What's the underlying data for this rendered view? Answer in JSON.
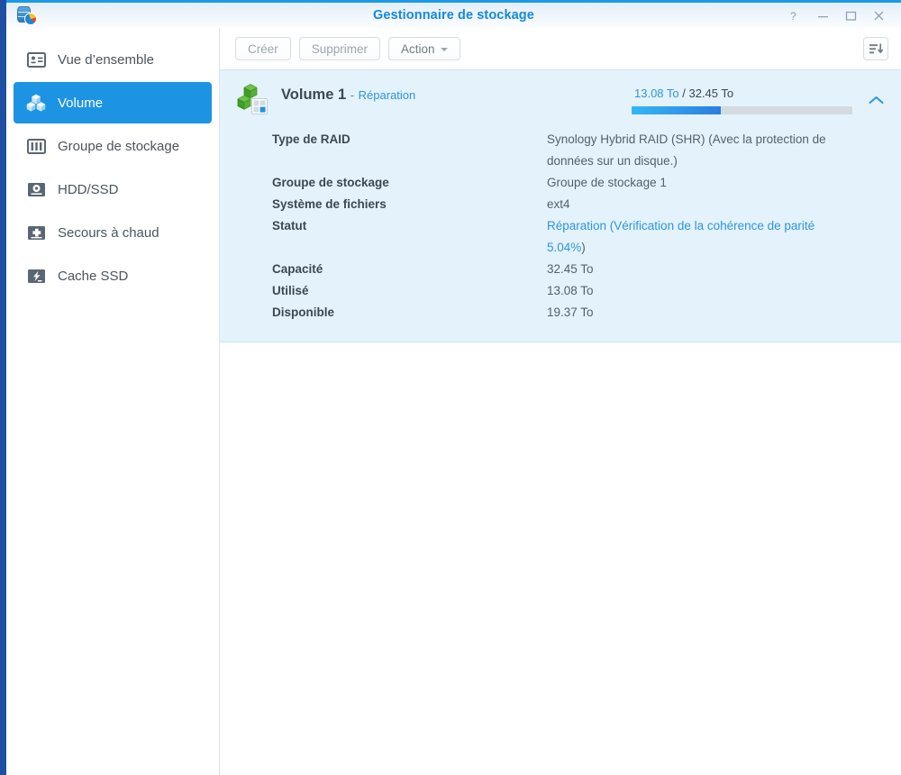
{
  "window": {
    "title": "Gestionnaire de stockage",
    "app_icon": "storage-manager-icon",
    "controls": {
      "help": "?",
      "minimize": "minimize-icon",
      "maximize": "maximize-icon",
      "close": "close-icon"
    }
  },
  "sidebar": {
    "items": [
      {
        "label": "Vue d’ensemble",
        "icon": "overview-icon",
        "active": false
      },
      {
        "label": "Volume",
        "icon": "volume-cubes-icon",
        "active": true
      },
      {
        "label": "Groupe de stockage",
        "icon": "storage-pool-icon",
        "active": false
      },
      {
        "label": "HDD/SSD",
        "icon": "disk-icon",
        "active": false
      },
      {
        "label": "Secours à chaud",
        "icon": "hot-spare-icon",
        "active": false
      },
      {
        "label": "Cache SSD",
        "icon": "ssd-cache-icon",
        "active": false
      }
    ]
  },
  "toolbar": {
    "create_label": "Créer",
    "delete_label": "Supprimer",
    "action_label": "Action",
    "sort_icon": "sort-list-icon"
  },
  "volume": {
    "icon": "volume-cubes-icon",
    "name": "Volume 1",
    "separator": "-",
    "state": "Réparation",
    "capacity_used_label": "13.08 To",
    "capacity_separator": " / ",
    "capacity_total_label": "32.45 To",
    "usage_percent": 40.3,
    "collapse_icon": "chevron-up-icon",
    "details": [
      {
        "label": "Type de RAID",
        "value": "Synology Hybrid RAID (SHR) (Avec la protection de données sur un disque.)",
        "link": false
      },
      {
        "label": "Groupe de stockage",
        "value": "Groupe de stockage 1",
        "link": false
      },
      {
        "label": "Système de fichiers",
        "value": "ext4",
        "link": false
      },
      {
        "label": "Statut",
        "value": "Réparation (Vérification de la cohérence de parité 5.04%",
        "value_tail": ")",
        "link": true
      },
      {
        "label": "Capacité",
        "value": "32.45 To",
        "link": false
      },
      {
        "label": "Utilisé",
        "value": "13.08 To",
        "link": false
      },
      {
        "label": "Disponible",
        "value": "19.37 To",
        "link": false
      }
    ]
  },
  "colors": {
    "accent_blue": "#1d93e4",
    "title_blue": "#1289dd",
    "panel_bg": "#e3f2fb",
    "desktop": "#1f4fa3"
  }
}
